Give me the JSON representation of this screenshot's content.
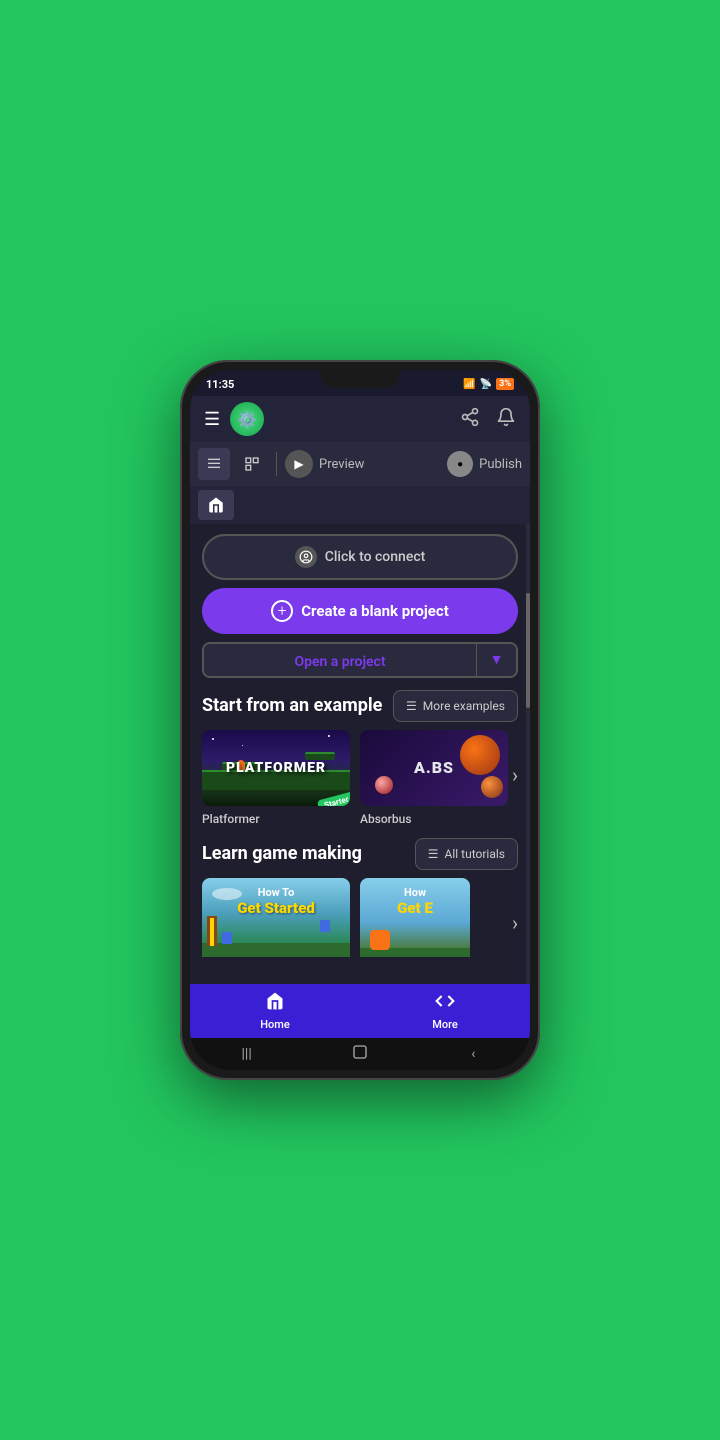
{
  "status_bar": {
    "time": "11:35",
    "battery": "3%"
  },
  "header": {
    "logo_icon": "⚙",
    "share_icon": "share",
    "bell_icon": "bell"
  },
  "toolbar": {
    "preview_label": "Preview",
    "publish_label": "Publish"
  },
  "connect_btn": {
    "label": "Click to connect",
    "icon": "😊"
  },
  "create_btn": {
    "label": "Create a blank project"
  },
  "open_project": {
    "label": "Open a project"
  },
  "start_section": {
    "title": "Start from an example",
    "more_btn": "More examples"
  },
  "examples": [
    {
      "label": "Platformer",
      "type": "platformer"
    },
    {
      "label": "Absorbus",
      "type": "absorbus"
    }
  ],
  "learn_section": {
    "title": "Learn game making",
    "more_btn": "All tutorials"
  },
  "tutorials": [
    {
      "line1": "How To",
      "line2": "Get Started",
      "type": "tutorial1"
    },
    {
      "line1": "How",
      "line2": "Get E",
      "type": "tutorial2"
    }
  ],
  "bottom_nav": {
    "home_label": "Home",
    "more_label": "More"
  },
  "system_nav": {
    "recent": "|||",
    "home": "○",
    "back": "‹"
  }
}
